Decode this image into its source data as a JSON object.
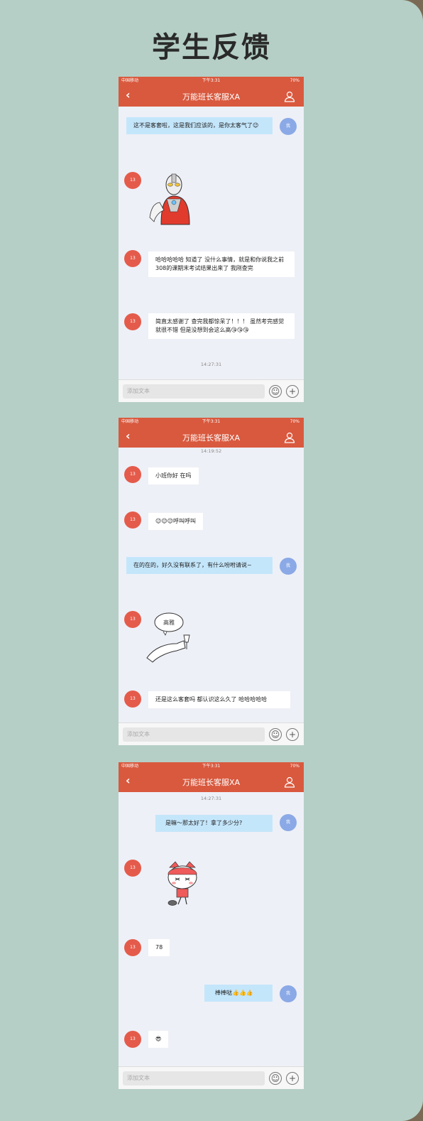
{
  "page": {
    "title": "学生反馈"
  },
  "status_bar": {
    "carrier": "中国移动",
    "carrier_2": "中国移动",
    "time": "下午3:31",
    "battery": "70%"
  },
  "navbar": {
    "title": "万能班长客服XA",
    "back_icon": "chevron-left-icon",
    "user_icon": "user-icon"
  },
  "input": {
    "placeholder": "添加文本"
  },
  "avatars": {
    "other": "13",
    "self": "我"
  },
  "screen1": {
    "msg1": "这不是客套啦，这是我们应该的，是你太客气了😉",
    "msg2": "哈哈哈哈哈 知道了 没什么事情，就是和你说我之前308的课期末考试结果出来了 我刚查完",
    "msg3": "简直太感谢了 查完我都惊呆了！！！ 虽然考完感觉就很不错 但是没想到会这么高😘😘😘",
    "time": "14:27:31"
  },
  "screen2": {
    "time": "14:19:52",
    "msg1": "小班你好 在吗",
    "msg2": "😉😉😉呼叫呼叫",
    "msg3": "在的在的，好久没有联系了，有什么吩咐请说~",
    "sticker_text": "高雅",
    "msg4": "还是这么客套吗 都认识这么久了 哈哈哈哈哈"
  },
  "screen3": {
    "time": "14:27:31",
    "msg1": "是嘛～那太好了！拿了多少分?",
    "msg2": "78",
    "msg3": "棒棒哒👍👍👍",
    "msg4": "😎"
  }
}
